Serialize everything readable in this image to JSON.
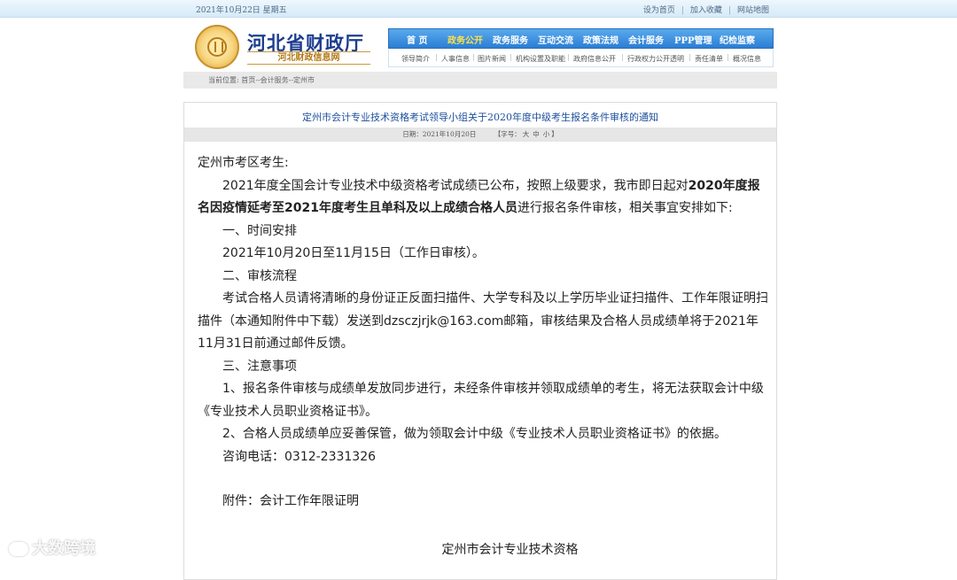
{
  "topbar": {
    "date": "2021年10月22日 星期五",
    "links": [
      "设为首页",
      "加入收藏",
      "网站地图"
    ]
  },
  "header": {
    "title": "河北省财政厅",
    "subtitle": "河北财政信息网",
    "nav": [
      "首 页",
      "政务公开",
      "政务服务",
      "互动交流",
      "政策法规",
      "会计服务",
      "PPP管理",
      "纪检监察"
    ],
    "nav_active": "政务公开",
    "subnav": [
      "领导简介",
      "人事信息",
      "图片新闻",
      "机构设置及职能",
      "政府信息公开",
      "行政权力公开透明",
      "责任清单",
      "概况信息"
    ]
  },
  "breadcrumb": "当前位置: 首页--会计服务--定州市",
  "article": {
    "title": "定州市会计专业技术资格考试领导小组关于2020年度中级考生报名条件审核的通知",
    "date": "日期：2021年10月20日",
    "font_size_label": "【字号：",
    "font_sizes": [
      "大",
      "中",
      "小"
    ],
    "font_size_close": "】",
    "greeting": "定州市考区考生:",
    "p1_a": "2021年度全国会计专业技术中级资格考试成绩已公布，按照上级要求，我市即日起对",
    "p1_bold": "2020年度报名因疫情延考至2021年度考生且单科及以上成绩合格人员",
    "p1_b": "进行报名条件审核，相关事宜安排如下:",
    "h1": "一、时间安排",
    "t1": "2021年10月20日至11月15日（工作日审核）。",
    "h2": "二、审核流程",
    "t2": "考试合格人员请将清晰的身份证正反面扫描件、大学专科及以上学历毕业证扫描件、工作年限证明扫描件（本通知附件中下载）发送到dzsczjrjk@163.com邮箱，审核结果及合格人员成绩单将于2021年11月31日前通过邮件反馈。",
    "h3": "三、注意事项",
    "n1": "1、报名条件审核与成绩单发放同步进行，未经条件审核并领取成绩单的考生，将无法获取会计中级《专业技术人员职业资格证书》。",
    "n2": "2、合格人员成绩单应妥善保管，做为领取会计中级《专业技术人员职业资格证书》的依据。",
    "phone": "咨询电话：0312-2331326",
    "attachment": "附件：会计工作年限证明",
    "signature": "定州市会计专业技术资格"
  },
  "watermark": "大数跨境"
}
